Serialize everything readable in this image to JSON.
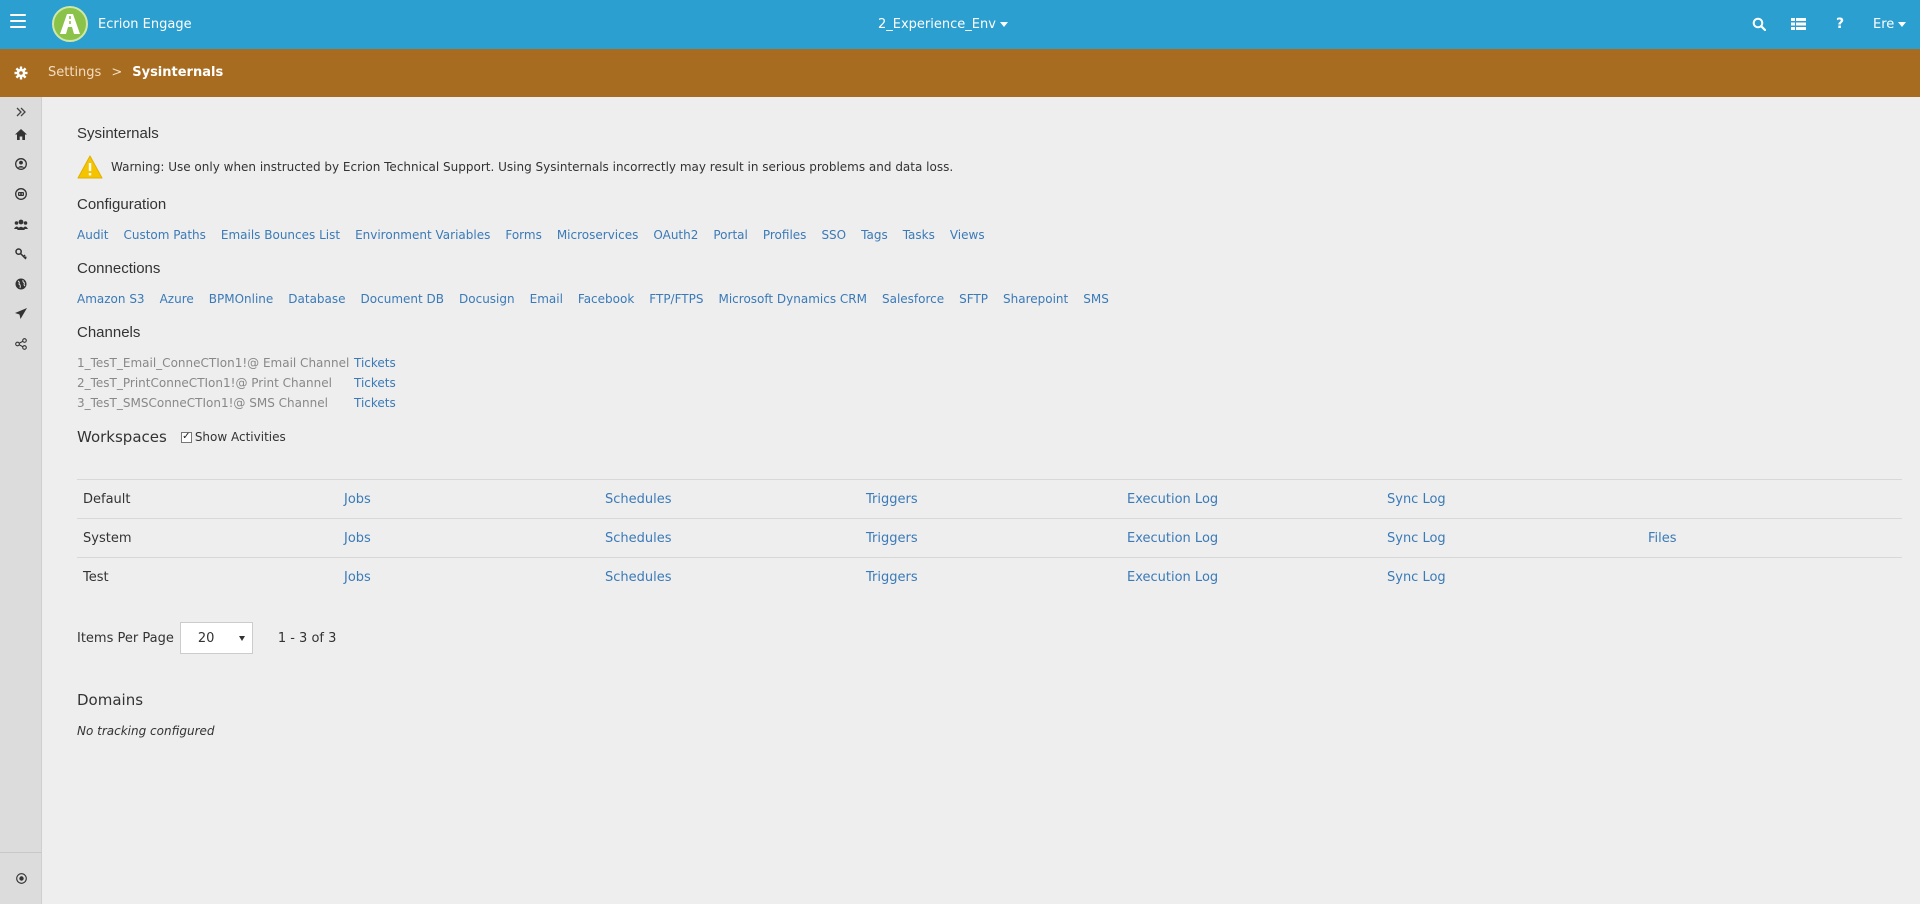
{
  "header": {
    "app_title": "Ecrion Engage",
    "environment": "2_Experience_Env",
    "user": "Ere",
    "colors": {
      "bar": "#2b9fd0",
      "logo": "#8bc34a"
    },
    "icons": [
      "menu-icon",
      "search-icon",
      "grid-icon",
      "help-icon"
    ]
  },
  "breadcrumb": {
    "parent": "Settings",
    "separator": ">",
    "current": "Sysinternals",
    "color": "#a86c21"
  },
  "sidebar": {
    "icons": [
      "expand-icon",
      "home-icon",
      "user-icon",
      "robot-icon",
      "users-icon",
      "key-icon",
      "globe-icon",
      "send-icon",
      "share-icon"
    ],
    "bottom_icon": "target-icon"
  },
  "page": {
    "title": "Sysinternals",
    "warning": "Warning: Use only when instructed by Ecrion Technical Support. Using Sysinternals incorrectly may result in serious problems and data loss."
  },
  "configuration": {
    "title": "Configuration",
    "links": [
      "Audit",
      "Custom Paths",
      "Emails Bounces List",
      "Environment Variables",
      "Forms",
      "Microservices",
      "OAuth2",
      "Portal",
      "Profiles",
      "SSO",
      "Tags",
      "Tasks",
      "Views"
    ]
  },
  "connections": {
    "title": "Connections",
    "links": [
      "Amazon S3",
      "Azure",
      "BPMOnline",
      "Database",
      "Document DB",
      "Docusign",
      "Email",
      "Facebook",
      "FTP/FTPS",
      "Microsoft Dynamics CRM",
      "Salesforce",
      "SFTP",
      "Sharepoint",
      "SMS"
    ]
  },
  "channels": {
    "title": "Channels",
    "items": [
      {
        "name": "1_TesT_Email_ConneCTIon1!@ Email Channel",
        "link": "Tickets"
      },
      {
        "name": "2_TesT_PrintConneCTIon1!@ Print Channel",
        "link": "Tickets"
      },
      {
        "name": "3_TesT_SMSConneCTIon1!@ SMS Channel",
        "link": "Tickets"
      }
    ]
  },
  "workspaces": {
    "title": "Workspaces",
    "show_activities_label": "Show Activities",
    "show_activities_checked": true,
    "rows": [
      {
        "name": "Default",
        "jobs": "Jobs",
        "schedules": "Schedules",
        "triggers": "Triggers",
        "execution_log": "Execution Log",
        "sync_log": "Sync Log",
        "files": ""
      },
      {
        "name": "System",
        "jobs": "Jobs",
        "schedules": "Schedules",
        "triggers": "Triggers",
        "execution_log": "Execution Log",
        "sync_log": "Sync Log",
        "files": "Files"
      },
      {
        "name": "Test",
        "jobs": "Jobs",
        "schedules": "Schedules",
        "triggers": "Triggers",
        "execution_log": "Execution Log",
        "sync_log": "Sync Log",
        "files": ""
      }
    ]
  },
  "pagination": {
    "label": "Items Per Page",
    "per_page": "20",
    "range": "1 - 3 of 3"
  },
  "domains": {
    "title": "Domains",
    "empty_text": "No tracking configured"
  }
}
